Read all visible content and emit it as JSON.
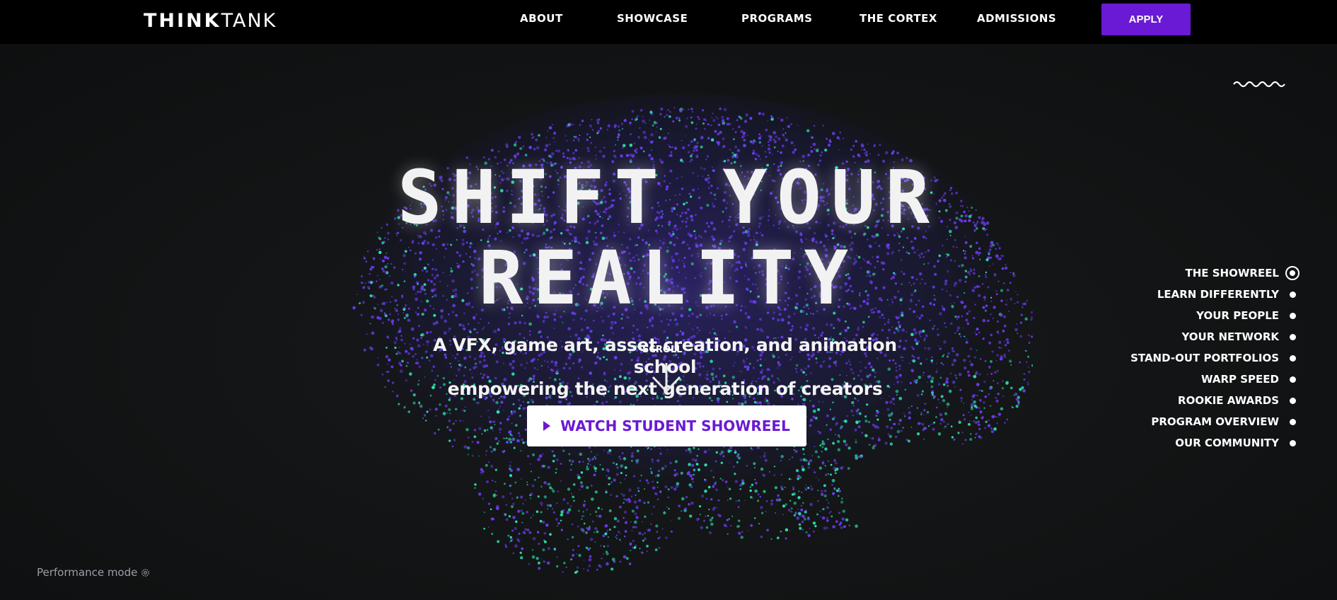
{
  "header": {
    "logo_bold": "THINK",
    "logo_light": "TANK",
    "nav": [
      "ABOUT",
      "SHOWCASE",
      "PROGRAMS",
      "THE CORTEX",
      "ADMISSIONS"
    ],
    "apply_label": "APPLY"
  },
  "hero": {
    "headline_line1": "SHIFT YOUR",
    "headline_line2": "REALITY",
    "subline1": "A VFX, game art, asset creation, and animation school",
    "subline2": "empowering the next generation of creators",
    "scroll_label": "SCROLL",
    "watch_label": "WATCH STUDENT SHOWREEL"
  },
  "side_nav": [
    {
      "label": "THE SHOWREEL",
      "active": true
    },
    {
      "label": "LEARN DIFFERENTLY",
      "active": false
    },
    {
      "label": "YOUR PEOPLE",
      "active": false
    },
    {
      "label": "YOUR NETWORK",
      "active": false
    },
    {
      "label": "STAND-OUT PORTFOLIOS",
      "active": false
    },
    {
      "label": "WARP SPEED",
      "active": false
    },
    {
      "label": "ROOKIE AWARDS",
      "active": false
    },
    {
      "label": "PROGRAM OVERVIEW",
      "active": false
    },
    {
      "label": "OUR COMMUNITY",
      "active": false
    }
  ],
  "footer": {
    "performance_mode": "Performance mode"
  },
  "colors": {
    "accent": "#6a1ad4",
    "particle_purple": "#6a3cf0",
    "particle_teal": "#2ee6b0"
  }
}
